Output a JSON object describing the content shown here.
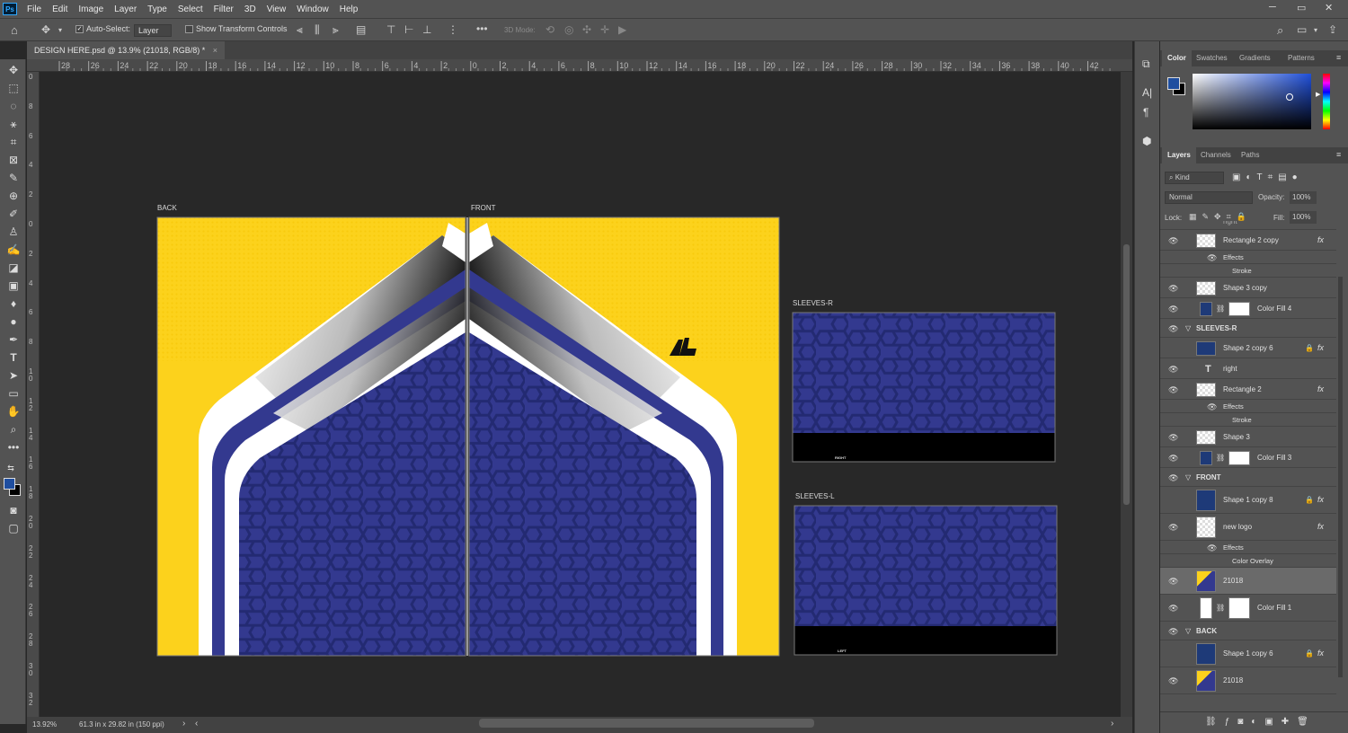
{
  "app": {
    "logo": "Ps"
  },
  "menu": [
    "File",
    "Edit",
    "Image",
    "Layer",
    "Type",
    "Select",
    "Filter",
    "3D",
    "View",
    "Window",
    "Help"
  ],
  "window_controls": {
    "minimize": "─",
    "restore": "▭",
    "close": "✕"
  },
  "options": {
    "auto_select_label": "Auto-Select:",
    "auto_select_value": "Layer",
    "show_transform_label": "Show Transform Controls",
    "mode_3d_label": "3D Mode:",
    "more": "•••"
  },
  "document": {
    "tab_title": "DESIGN HERE.psd @ 13.9% (21018, RGB/8) *",
    "close": "×",
    "zoom": "13.92%",
    "doc_info": "61.3 in x 29.82 in (150 ppi)"
  },
  "ruler_h": [
    "28",
    "26",
    "24",
    "22",
    "20",
    "18",
    "16",
    "14",
    "12",
    "10",
    "8",
    "6",
    "4",
    "2",
    "0",
    "2",
    "4",
    "6",
    "8",
    "10",
    "12",
    "14",
    "16",
    "18",
    "20",
    "22",
    "24",
    "26",
    "28",
    "30",
    "32",
    "34",
    "36",
    "38",
    "40",
    "42"
  ],
  "ruler_v": [
    "0",
    "8",
    "6",
    "4",
    "2",
    "0",
    "2",
    "4",
    "6",
    "8",
    "1 0",
    "1 2",
    "1 4",
    "1 6",
    "1 8",
    "2 0",
    "2 2",
    "2 4",
    "2 6",
    "2 8",
    "3 0",
    "3 2"
  ],
  "artboards": {
    "back": "BACK",
    "front": "FRONT",
    "sleeves_r": "SLEEVES-R",
    "sleeves_l": "SLEEVES-L",
    "sleeve_r_text": "RIGHT",
    "sleeve_l_text": "LEFT"
  },
  "colors": {
    "jersey_yellow": "#fcd21c",
    "jersey_navy": "#33398f",
    "hex_line": "#232a72",
    "foreground": "#1f4e9f",
    "background": "#000000"
  },
  "color_panel": {
    "tabs": [
      "Color",
      "Swatches",
      "Gradients",
      "Patterns"
    ]
  },
  "layers_panel": {
    "tabs": [
      "Layers",
      "Channels",
      "Paths"
    ],
    "kind_label": "Kind",
    "blend_mode": "Normal",
    "opacity_label": "Opacity:",
    "opacity_value": "100%",
    "lock_label": "Lock:",
    "fill_label": "Fill:",
    "fill_value": "100%",
    "rows": [
      {
        "name": "right",
        "kind": "cut"
      },
      {
        "name": "Rectangle 2 copy",
        "kind": "layer",
        "fx": true,
        "thumb": "checker"
      },
      {
        "name": "Effects",
        "kind": "sub"
      },
      {
        "name": "Stroke",
        "kind": "sub2"
      },
      {
        "name": "Shape 3 copy",
        "kind": "layer",
        "thumb": "checker"
      },
      {
        "name": "Color Fill 4",
        "kind": "fill",
        "thumb": "navy"
      },
      {
        "name": "SLEEVES-R",
        "kind": "group"
      },
      {
        "name": "Shape 2 copy 6",
        "kind": "layer",
        "fx": true,
        "lock": true,
        "hidden": true,
        "thumb": "navy"
      },
      {
        "name": "right",
        "kind": "text"
      },
      {
        "name": "Rectangle 2",
        "kind": "layer",
        "fx": true,
        "thumb": "checker"
      },
      {
        "name": "Effects",
        "kind": "sub"
      },
      {
        "name": "Stroke",
        "kind": "sub2"
      },
      {
        "name": "Shape 3",
        "kind": "layer",
        "thumb": "checker"
      },
      {
        "name": "Color Fill 3",
        "kind": "fill",
        "thumb": "navy"
      },
      {
        "name": "FRONT",
        "kind": "group"
      },
      {
        "name": "Shape 1 copy 8",
        "kind": "layer",
        "fx": true,
        "lock": true,
        "hidden": true,
        "thumb": "navy",
        "tall": true
      },
      {
        "name": "new logo",
        "kind": "layer",
        "fx": true,
        "thumb": "checker",
        "tall": true
      },
      {
        "name": "Effects",
        "kind": "sub"
      },
      {
        "name": "Color Overlay",
        "kind": "sub2"
      },
      {
        "name": "21018",
        "kind": "layer",
        "thumb": "jersey",
        "tall": true,
        "selected": true
      },
      {
        "name": "Color Fill 1",
        "kind": "fill",
        "thumb": "white",
        "tall": true
      },
      {
        "name": "BACK",
        "kind": "group"
      },
      {
        "name": "Shape 1 copy 6",
        "kind": "layer",
        "fx": true,
        "lock": true,
        "hidden": true,
        "thumb": "navy",
        "tall": true
      },
      {
        "name": "21018",
        "kind": "layer",
        "thumb": "jersey",
        "tall": true
      }
    ]
  }
}
